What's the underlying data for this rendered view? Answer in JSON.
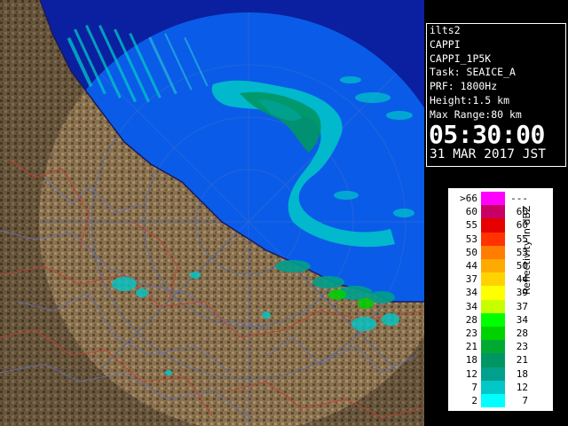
{
  "info": {
    "site": "ilts2",
    "product": "CAPPI",
    "product_code": "CAPPI_1P5K",
    "task": "Task: SEAICE_A",
    "prf": "PRF: 1800Hz",
    "height": "Height:1.5 km",
    "max_range": "Max Range:80 km",
    "time": "05:30:00",
    "date": "31 MAR 2017 JST"
  },
  "legend": {
    "title": "Reflectivity in dBZ",
    "rows": [
      {
        "lo": ">66",
        "hi": "---",
        "color": "#ff00ff"
      },
      {
        "lo": "60",
        "hi": "66",
        "color": "#c80064"
      },
      {
        "lo": "55",
        "hi": "60",
        "color": "#e60000"
      },
      {
        "lo": "53",
        "hi": "55",
        "color": "#ff3200"
      },
      {
        "lo": "50",
        "hi": "53",
        "color": "#ff7d00"
      },
      {
        "lo": "44",
        "hi": "50",
        "color": "#ffaa00"
      },
      {
        "lo": "37",
        "hi": "44",
        "color": "#ffd200"
      },
      {
        "lo": "34",
        "hi": "39",
        "color": "#ffff00"
      },
      {
        "lo": "34",
        "hi": "37",
        "color": "#c8ff00"
      },
      {
        "lo": "28",
        "hi": "34",
        "color": "#00ff00"
      },
      {
        "lo": "23",
        "hi": "28",
        "color": "#00d200"
      },
      {
        "lo": "21",
        "hi": "23",
        "color": "#00aa32"
      },
      {
        "lo": "18",
        "hi": "21",
        "color": "#009664"
      },
      {
        "lo": "12",
        "hi": "18",
        "color": "#00a08c"
      },
      {
        "lo": "7",
        "hi": "12",
        "color": "#00c8c8"
      },
      {
        "lo": "2",
        "hi": "7",
        "color": "#00ffff"
      }
    ]
  },
  "map": {
    "sea_color": "#0a5ce8",
    "outside_color": "#0a20a0",
    "land_color": "#8a7250",
    "echo_colors": [
      "#00c8c8",
      "#00a08c",
      "#2ee0d0",
      "#009664",
      "#00d200"
    ]
  }
}
